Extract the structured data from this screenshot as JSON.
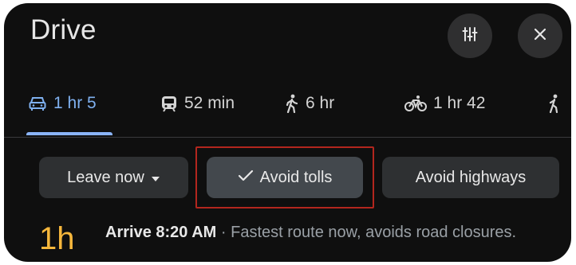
{
  "header": {
    "title": "Drive"
  },
  "modes": [
    {
      "icon": "car-icon",
      "label": "1 hr 5",
      "active": true
    },
    {
      "icon": "transit-icon",
      "label": "52 min",
      "active": false
    },
    {
      "icon": "walking-icon",
      "label": "6 hr",
      "active": false
    },
    {
      "icon": "bicycle-icon",
      "label": "1 hr 42",
      "active": false
    },
    {
      "icon": "walking-partial-icon",
      "label": "",
      "active": false
    }
  ],
  "chips": {
    "leave_now": "Leave now",
    "avoid_tolls": "Avoid tolls",
    "avoid_highways": "Avoid highways"
  },
  "route": {
    "eta": "1h",
    "arrive": "Arrive 8:20 AM",
    "separator": " · ",
    "description": "Fastest route now, avoids road closures."
  },
  "colors": {
    "background": "#0f0f0f",
    "active_mode": "#7fb0ef",
    "eta": "#f6b73c",
    "highlight_box": "#b3261e"
  }
}
